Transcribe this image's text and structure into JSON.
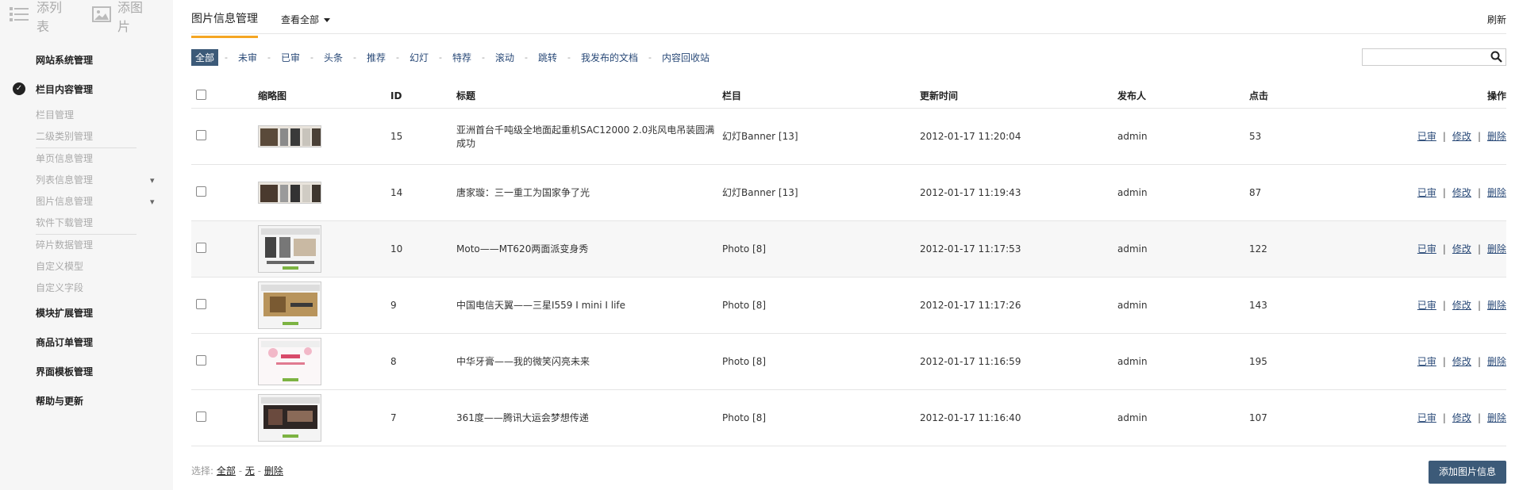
{
  "sidebar": {
    "top_buttons": [
      {
        "label": "添列表",
        "icon": "list-icon"
      },
      {
        "label": "添图片",
        "icon": "image-icon"
      }
    ],
    "groups": {
      "g0": {
        "label": "网站系统管理"
      },
      "g1": {
        "label": "栏目内容管理",
        "icon": "checkmark-circle-icon",
        "items": [
          "栏目管理",
          "二级类别管理",
          "单页信息管理",
          "列表信息管理",
          "图片信息管理",
          "软件下载管理",
          "碎片数据管理",
          "自定义模型",
          "自定义字段"
        ]
      },
      "g2": {
        "label": "模块扩展管理"
      },
      "g3": {
        "label": "商品订单管理"
      },
      "g4": {
        "label": "界面模板管理"
      },
      "g5": {
        "label": "帮助与更新"
      }
    }
  },
  "header": {
    "title": "图片信息管理",
    "view_all": "查看全部",
    "refresh": "刷新"
  },
  "filters": [
    "全部",
    "未审",
    "已审",
    "头条",
    "推荐",
    "幻灯",
    "特荐",
    "滚动",
    "跳转",
    "我发布的文档",
    "内容回收站"
  ],
  "filter_separator": "-",
  "search": {
    "placeholder": ""
  },
  "table": {
    "headers": [
      "缩略图",
      "ID",
      "标题",
      "栏目",
      "更新时间",
      "发布人",
      "点击",
      "操作"
    ],
    "rows": [
      {
        "id": "15",
        "title": "亚洲首台千吨级全地面起重机SAC12000 2.0兆风电吊装圆满成功",
        "column": "幻灯Banner [13]",
        "time": "2012-01-17 11:20:04",
        "author": "admin",
        "clicks": "53",
        "ops": [
          "已审",
          "修改",
          "删除"
        ]
      },
      {
        "id": "14",
        "title": "唐家璇：三一重工为国家争了光",
        "column": "幻灯Banner [13]",
        "time": "2012-01-17 11:19:43",
        "author": "admin",
        "clicks": "87",
        "ops": [
          "已审",
          "修改",
          "删除"
        ]
      },
      {
        "id": "10",
        "title": "Moto——MT620两面派变身秀",
        "column": "Photo [8]",
        "time": "2012-01-17 11:17:53",
        "author": "admin",
        "clicks": "122",
        "ops": [
          "已审",
          "修改",
          "删除"
        ]
      },
      {
        "id": "9",
        "title": "中国电信天翼——三星I559 I mini I life",
        "column": "Photo [8]",
        "time": "2012-01-17 11:17:26",
        "author": "admin",
        "clicks": "143",
        "ops": [
          "已审",
          "修改",
          "删除"
        ]
      },
      {
        "id": "8",
        "title": "中华牙膏——我的微笑闪亮未来",
        "column": "Photo [8]",
        "time": "2012-01-17 11:16:59",
        "author": "admin",
        "clicks": "195",
        "ops": [
          "已审",
          "修改",
          "删除"
        ]
      },
      {
        "id": "7",
        "title": "361度——腾讯大运会梦想传递",
        "column": "Photo [8]",
        "time": "2012-01-17 11:16:40",
        "author": "admin",
        "clicks": "107",
        "ops": [
          "已审",
          "修改",
          "删除"
        ]
      }
    ]
  },
  "footer": {
    "label": "选择:",
    "all": "全部",
    "none": "无",
    "delete": "删除",
    "sep": "-"
  },
  "add_button": "添加图片信息",
  "colors": {
    "accent_underline": "#f5a623",
    "primary_button": "#3c5a78",
    "link": "#2a4a78"
  }
}
